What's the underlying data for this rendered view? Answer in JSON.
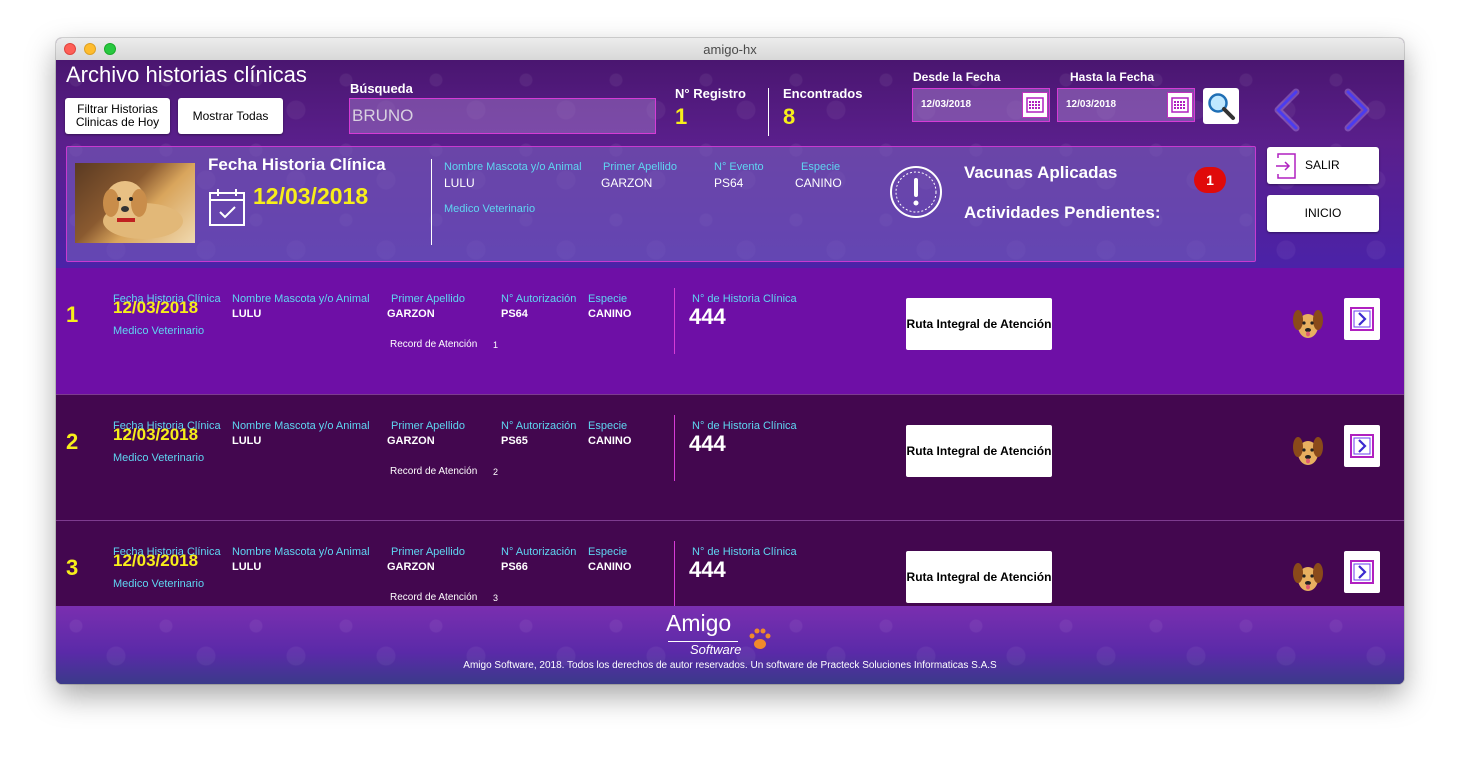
{
  "window": {
    "title": "amigo-hx"
  },
  "header": {
    "app_title": "Archivo historias clínicas",
    "filter_today_label": "Filtrar Historias Clinicas de Hoy",
    "show_all_label": "Mostrar Todas",
    "search_label": "Búsqueda",
    "search_value": "BRUNO",
    "registro_label": "N° Registro",
    "registro_value": "1",
    "encontrados_label": "Encontrados",
    "encontrados_value": "8",
    "desde_label": "Desde la Fecha",
    "desde_value": "12/03/2018",
    "hasta_label": "Hasta la Fecha",
    "hasta_value": "12/03/2018"
  },
  "card": {
    "title": "Fecha Historia Clínica",
    "date": "12/03/2018",
    "mascota_label": "Nombre Mascota y/o Animal",
    "mascota_value": "LULU",
    "apellido_label": "Primer Apellido",
    "apellido_value": "GARZON",
    "evento_label": "N° Evento",
    "evento_value": "PS64",
    "especie_label": "Especie",
    "especie_value": "CANINO",
    "medico_label": "Medico Veterinario",
    "vacunas_label": "Vacunas Aplicadas",
    "actividades_label": "Actividades Pendientes:",
    "badge_count": "1"
  },
  "side_buttons": {
    "salir": "SALIR",
    "inicio": "INICIO"
  },
  "rows": [
    {
      "num": "1",
      "fecha_label": "Fecha Historia Clínica",
      "fecha": "12/03/2018",
      "medico_label": "Medico Veterinario",
      "mascota_label": "Nombre Mascota y/o Animal",
      "mascota": "LULU",
      "apellido_label": "Primer Apellido",
      "apellido": "GARZON",
      "autorizacion_label": "N° Autorización",
      "autorizacion": "PS64",
      "especie_label": "Especie",
      "especie": "CANINO",
      "record_label": "Record de Atención",
      "record": "1",
      "hist_label": "N° de Historia Clínica",
      "hist": "444",
      "ruta_label": "Ruta Integral de Atención"
    },
    {
      "num": "2",
      "fecha_label": "Fecha Historia Clínica",
      "fecha": "12/03/2018",
      "medico_label": "Medico Veterinario",
      "mascota_label": "Nombre Mascota y/o Animal",
      "mascota": "LULU",
      "apellido_label": "Primer Apellido",
      "apellido": "GARZON",
      "autorizacion_label": "N° Autorización",
      "autorizacion": "PS65",
      "especie_label": "Especie",
      "especie": "CANINO",
      "record_label": "Record de Atención",
      "record": "2",
      "hist_label": "N° de Historia Clínica",
      "hist": "444",
      "ruta_label": "Ruta Integral de Atención"
    },
    {
      "num": "3",
      "fecha_label": "Fecha Historia Clínica",
      "fecha": "12/03/2018",
      "medico_label": "Medico Veterinario",
      "mascota_label": "Nombre Mascota y/o Animal",
      "mascota": "LULU",
      "apellido_label": "Primer Apellido",
      "apellido": "GARZON",
      "autorizacion_label": "N° Autorización",
      "autorizacion": "PS66",
      "especie_label": "Especie",
      "especie": "CANINO",
      "record_label": "Record de Atención",
      "record": "3",
      "hist_label": "N° de Historia Clínica",
      "hist": "444",
      "ruta_label": "Ruta Integral de Atención"
    }
  ],
  "footer": {
    "logo": "Amigo",
    "sub": "Software",
    "copyright": "Amigo Software, 2018. Todos los derechos de autor reservados. Un software de Practeck Soluciones Informaticas S.A.S"
  },
  "icons": [
    "calendar-icon",
    "search-icon",
    "prev-arrow-icon",
    "next-arrow-icon",
    "alert-icon",
    "exit-icon",
    "dog-icon",
    "go-icon",
    "paw-icon"
  ],
  "colors": {
    "accent_yellow": "#f7ee1a",
    "label_cyan": "#5fd6f2",
    "border_magenta": "#d63bd6",
    "row_active": "#6e0fa6",
    "row_default": "#43074f",
    "badge_red": "#e00a0a"
  }
}
